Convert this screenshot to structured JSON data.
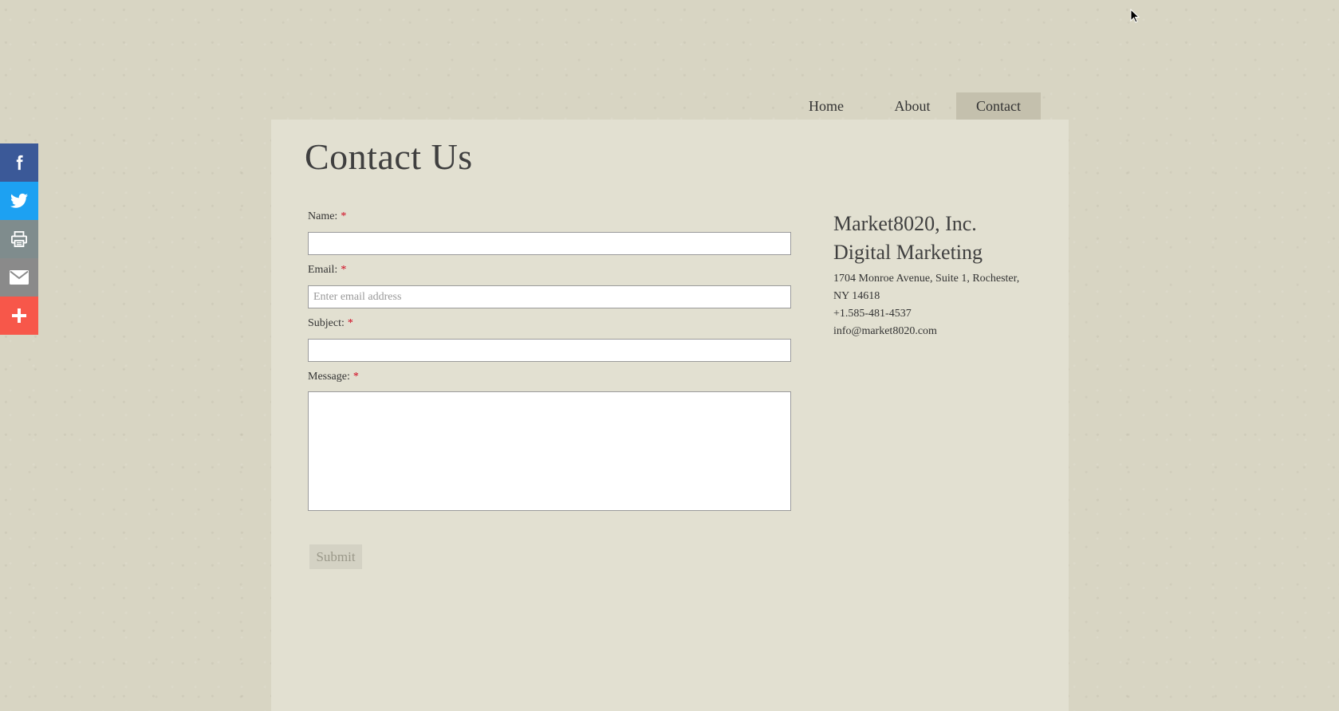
{
  "share_bar": {
    "items": [
      {
        "icon": "facebook-icon",
        "color": "#3b5998"
      },
      {
        "icon": "twitter-icon",
        "color": "#1da1f2"
      },
      {
        "icon": "print-icon",
        "color": "#7f8c8d"
      },
      {
        "icon": "email-icon",
        "color": "#8a8a8a"
      },
      {
        "icon": "plus-icon",
        "color": "#f7574a"
      }
    ]
  },
  "nav": {
    "items": [
      {
        "label": "Home"
      },
      {
        "label": "About"
      },
      {
        "label": "Contact",
        "active": true
      }
    ]
  },
  "page": {
    "title": "Contact Us"
  },
  "form": {
    "name_label": "Name:",
    "email_label": "Email:",
    "email_placeholder": "Enter email address",
    "subject_label": "Subject:",
    "message_label": "Message:",
    "required_marker": "*",
    "submit_label": "Submit"
  },
  "company": {
    "name": "Market8020, Inc.",
    "tagline": "Digital Marketing",
    "address_line1": "1704 Monroe Avenue, Suite 1, Rochester,",
    "address_line2": "NY 14618",
    "phone": "+1.585-481-4537",
    "email": "info@market8020.com"
  }
}
